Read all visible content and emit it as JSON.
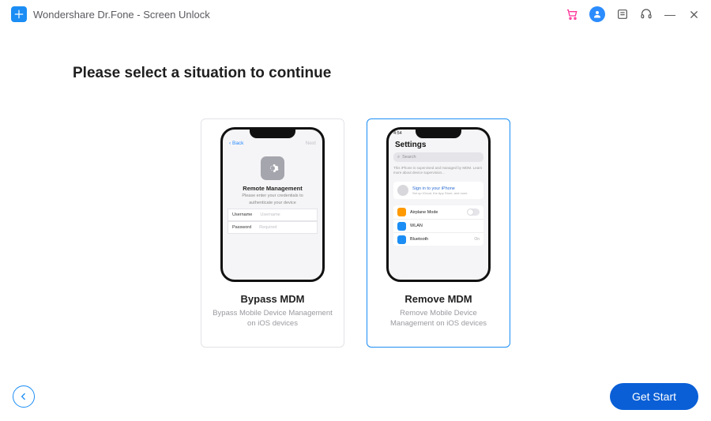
{
  "titlebar": {
    "title": "Wondershare Dr.Fone - Screen Unlock"
  },
  "page": {
    "heading": "Please select a situation to continue"
  },
  "cards": {
    "bypass": {
      "title": "Bypass MDM",
      "desc": "Bypass Mobile Device Management on iOS devices"
    },
    "remove": {
      "title": "Remove MDM",
      "desc": "Remove Mobile Device Management on iOS devices"
    }
  },
  "phoneA": {
    "back": "Back",
    "next": "Next",
    "heading": "Remote Management",
    "sub1": "Please enter your credentials to",
    "sub2": "authenticate your device",
    "usernameLabel": "Username",
    "usernamePh": "Username",
    "passwordLabel": "Password",
    "passwordPh": "Required"
  },
  "phoneB": {
    "time": "4:54",
    "title": "Settings",
    "search": "Search",
    "warn1": "This iPhone is supervised and managed by",
    "warn2": "MDM",
    "warn3": ". Learn more about device supervision...",
    "signin": "Sign in to your iPhone",
    "signinSub": "Set up iCloud, the App Store, and more",
    "row1": "Airplane Mode",
    "row2": "WLAN",
    "row2val": "",
    "row3": "Bluetooth",
    "row3val": "On"
  },
  "footer": {
    "start": "Get Start"
  },
  "colors": {
    "orange": "#ff9900",
    "blue": "#1b8df4",
    "bluealt": "#2b8cff"
  }
}
